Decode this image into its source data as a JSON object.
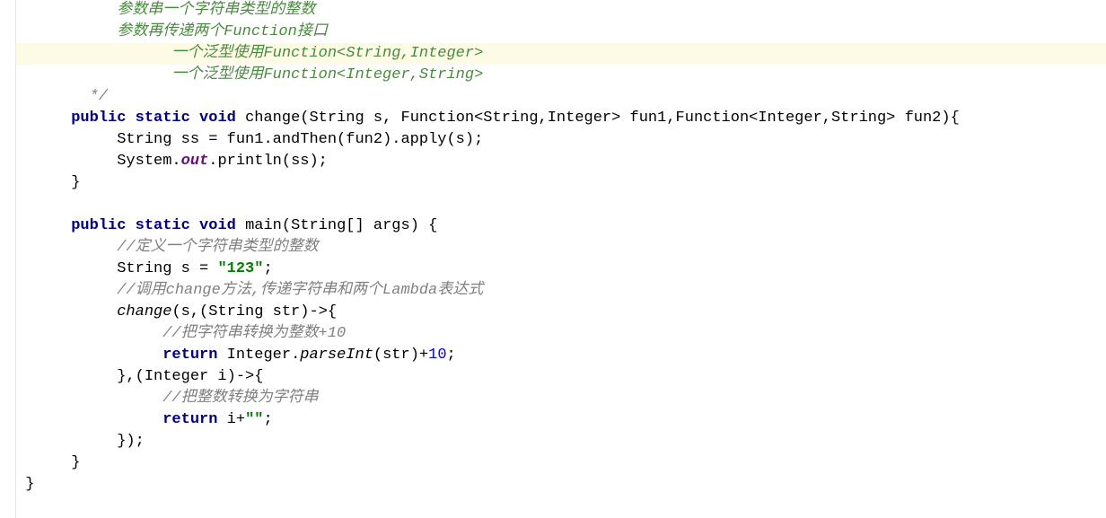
{
  "code": {
    "lines": [
      {
        "indent": 11,
        "segments": [
          {
            "t": "参数串一个字符串类型的整数",
            "c": "comment-green"
          }
        ]
      },
      {
        "indent": 11,
        "segments": [
          {
            "t": "参数再传递两个",
            "c": "comment-green"
          },
          {
            "t": "Function",
            "c": "comment-green"
          },
          {
            "t": "接口",
            "c": "comment-green"
          }
        ]
      },
      {
        "indent": 17,
        "highlighted": true,
        "segments": [
          {
            "t": "一个泛型使用",
            "c": "comment-green"
          },
          {
            "t": "Function<String,Integer>",
            "c": "comment-green"
          }
        ]
      },
      {
        "indent": 17,
        "segments": [
          {
            "t": "一个泛型使用",
            "c": "comment-green"
          },
          {
            "t": "Function<Integer,String>",
            "c": "comment-green"
          }
        ]
      },
      {
        "indent": 8,
        "segments": [
          {
            "t": "*/",
            "c": "comment"
          }
        ]
      },
      {
        "indent": 6,
        "segments": [
          {
            "t": "public static void ",
            "c": "keyword"
          },
          {
            "t": "change(String s, Function<String,Integer> fun1,Function<Integer,String> fun2){",
            "c": "normal"
          }
        ]
      },
      {
        "indent": 11,
        "segments": [
          {
            "t": "String ss = fun1.andThen(fun2).apply(s);",
            "c": "normal"
          }
        ]
      },
      {
        "indent": 11,
        "segments": [
          {
            "t": "System.",
            "c": "normal"
          },
          {
            "t": "out",
            "c": "field-static"
          },
          {
            "t": ".println(ss);",
            "c": "normal"
          }
        ]
      },
      {
        "indent": 6,
        "segments": [
          {
            "t": "}",
            "c": "normal"
          }
        ]
      },
      {
        "indent": 0,
        "segments": []
      },
      {
        "indent": 6,
        "segments": [
          {
            "t": "public static void ",
            "c": "keyword"
          },
          {
            "t": "main(String[] args) {",
            "c": "normal"
          }
        ]
      },
      {
        "indent": 11,
        "segments": [
          {
            "t": "//定义一个字符串类型的整数",
            "c": "comment"
          }
        ]
      },
      {
        "indent": 11,
        "segments": [
          {
            "t": "String s = ",
            "c": "normal"
          },
          {
            "t": "\"123\"",
            "c": "string"
          },
          {
            "t": ";",
            "c": "normal"
          }
        ]
      },
      {
        "indent": 11,
        "segments": [
          {
            "t": "//调用",
            "c": "comment"
          },
          {
            "t": "change",
            "c": "comment"
          },
          {
            "t": "方法,传递字符串和两个",
            "c": "comment"
          },
          {
            "t": "Lambda",
            "c": "comment"
          },
          {
            "t": "表达式",
            "c": "comment"
          }
        ]
      },
      {
        "indent": 11,
        "segments": [
          {
            "t": "change",
            "c": "method-static"
          },
          {
            "t": "(s,(String str)->{",
            "c": "normal"
          }
        ]
      },
      {
        "indent": 16,
        "segments": [
          {
            "t": "//把字符串转换为整数+10",
            "c": "comment"
          }
        ]
      },
      {
        "indent": 16,
        "segments": [
          {
            "t": "return ",
            "c": "keyword"
          },
          {
            "t": "Integer.",
            "c": "normal"
          },
          {
            "t": "parseInt",
            "c": "method-static"
          },
          {
            "t": "(str)+",
            "c": "normal"
          },
          {
            "t": "10",
            "c": "number"
          },
          {
            "t": ";",
            "c": "normal"
          }
        ]
      },
      {
        "indent": 11,
        "segments": [
          {
            "t": "},(Integer i)->{",
            "c": "normal"
          }
        ]
      },
      {
        "indent": 16,
        "segments": [
          {
            "t": "//把整数转换为字符串",
            "c": "comment"
          }
        ]
      },
      {
        "indent": 16,
        "segments": [
          {
            "t": "return ",
            "c": "keyword"
          },
          {
            "t": "i+",
            "c": "normal"
          },
          {
            "t": "\"\"",
            "c": "string"
          },
          {
            "t": ";",
            "c": "normal"
          }
        ]
      },
      {
        "indent": 11,
        "segments": [
          {
            "t": "});",
            "c": "normal"
          }
        ]
      },
      {
        "indent": 6,
        "segments": [
          {
            "t": "}",
            "c": "normal"
          }
        ]
      },
      {
        "indent": 1,
        "segments": [
          {
            "t": "}",
            "c": "normal"
          }
        ]
      }
    ],
    "caret_line_index": 17,
    "caret_offset_chars": 20
  }
}
